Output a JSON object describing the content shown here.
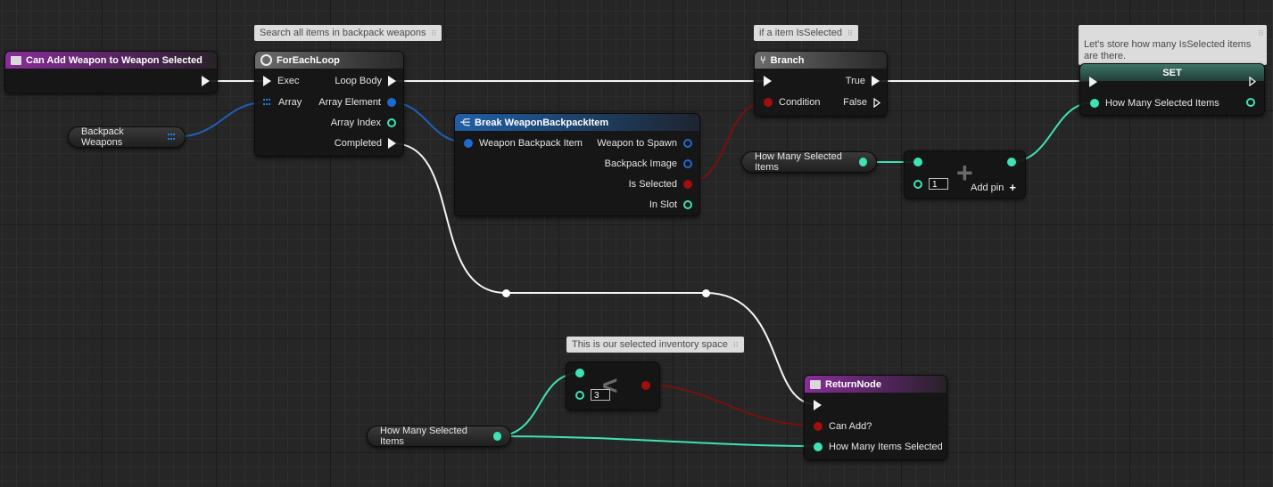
{
  "comments": {
    "foreach": "Search all items in backpack weapons",
    "branch": "if a item IsSelected",
    "set": "Let's store how many IsSelected items\nare there.",
    "compare": "This is our selected inventory space"
  },
  "entry_node": {
    "title": "Can Add Weapon to Weapon Selected"
  },
  "backpack_var": {
    "label": "Backpack Weapons"
  },
  "foreach_node": {
    "title": "ForEachLoop",
    "exec_in": "Exec",
    "array_in": "Array",
    "loop_body": "Loop Body",
    "array_element": "Array Element",
    "array_index": "Array Index",
    "completed": "Completed"
  },
  "break_node": {
    "title": "Break WeaponBackpackItem",
    "input": "Weapon Backpack Item",
    "outputs": [
      "Weapon to Spawn",
      "Backpack Image",
      "Is Selected",
      "In Slot"
    ]
  },
  "branch_node": {
    "title": "Branch",
    "condition": "Condition",
    "true_label": "True",
    "false_label": "False"
  },
  "set_node": {
    "title": "SET",
    "pin": "How Many Selected Items"
  },
  "get_var_top": {
    "label": "How Many Selected Items"
  },
  "add_node": {
    "value": "1",
    "add_pin": "Add pin"
  },
  "compare_node": {
    "value": "3"
  },
  "get_var_bottom": {
    "label": "How Many Selected Items"
  },
  "return_node": {
    "title": "ReturnNode",
    "can_add": "Can Add?",
    "how_many": "How Many Items Selected"
  },
  "colors": {
    "exec": "#f2f2f2",
    "bool": "#a10e0e",
    "int": "#3ee3b5",
    "struct": "#1f6ad1",
    "function_header": "#8a2d9a"
  }
}
